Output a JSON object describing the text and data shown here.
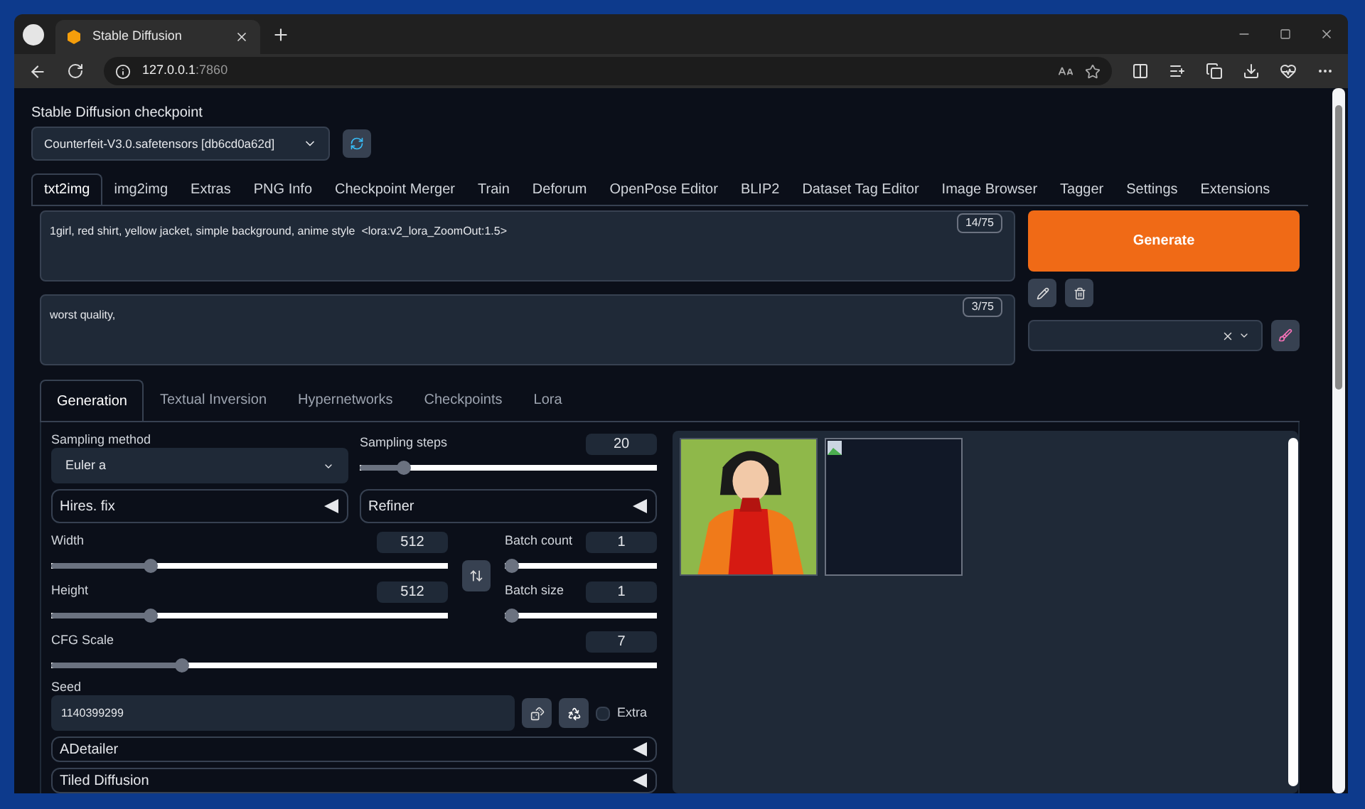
{
  "browser": {
    "tab_title": "Stable Diffusion",
    "url_host": "127.0.0.1",
    "url_port": ":7860"
  },
  "checkpoint": {
    "label": "Stable Diffusion checkpoint",
    "value": "Counterfeit-V3.0.safetensors [db6cd0a62d]"
  },
  "main_tabs": [
    {
      "label": "txt2img",
      "selected": true
    },
    {
      "label": "img2img",
      "selected": false
    },
    {
      "label": "Extras",
      "selected": false
    },
    {
      "label": "PNG Info",
      "selected": false
    },
    {
      "label": "Checkpoint Merger",
      "selected": false
    },
    {
      "label": "Train",
      "selected": false
    },
    {
      "label": "Deforum",
      "selected": false
    },
    {
      "label": "OpenPose Editor",
      "selected": false
    },
    {
      "label": "BLIP2",
      "selected": false
    },
    {
      "label": "Dataset Tag Editor",
      "selected": false
    },
    {
      "label": "Image Browser",
      "selected": false
    },
    {
      "label": "Tagger",
      "selected": false
    },
    {
      "label": "Settings",
      "selected": false
    },
    {
      "label": "Extensions",
      "selected": false
    }
  ],
  "prompt": {
    "value": "1girl, red shirt, yellow jacket, simple background, anime style  <lora:v2_lora_ZoomOut:1.5>",
    "counter": "14/75"
  },
  "negative_prompt": {
    "value": "worst quality,",
    "counter": "3/75"
  },
  "generate": "Generate",
  "sub_tabs": [
    {
      "label": "Generation",
      "selected": true
    },
    {
      "label": "Textual Inversion",
      "selected": false
    },
    {
      "label": "Hypernetworks",
      "selected": false
    },
    {
      "label": "Checkpoints",
      "selected": false
    },
    {
      "label": "Lora",
      "selected": false
    }
  ],
  "sampling_method": {
    "label": "Sampling method",
    "value": "Euler a"
  },
  "sampling_steps": {
    "label": "Sampling steps",
    "value": "20",
    "level": 0.13
  },
  "hires_fix": {
    "label": "Hires. fix",
    "expanded": false
  },
  "refiner": {
    "label": "Refiner",
    "expanded": false
  },
  "width": {
    "label": "Width",
    "value": "512",
    "level": 0.24
  },
  "height": {
    "label": "Height",
    "value": "512",
    "level": 0.24
  },
  "batch_count": {
    "label": "Batch count",
    "value": "1",
    "level": 0
  },
  "batch_size": {
    "label": "Batch size",
    "value": "1",
    "level": 0
  },
  "cfg_scale": {
    "label": "CFG Scale",
    "value": "7",
    "level": 0.21
  },
  "seed": {
    "label": "Seed",
    "value": "1140399299"
  },
  "extra": {
    "label": "Extra",
    "checked": false
  },
  "adetailer": {
    "label": "ADetailer",
    "expanded": false
  },
  "tiled_diffusion": {
    "label": "Tiled Diffusion",
    "expanded": false
  },
  "gallery": [
    {
      "kind": "picture"
    },
    {
      "kind": "broken"
    }
  ]
}
